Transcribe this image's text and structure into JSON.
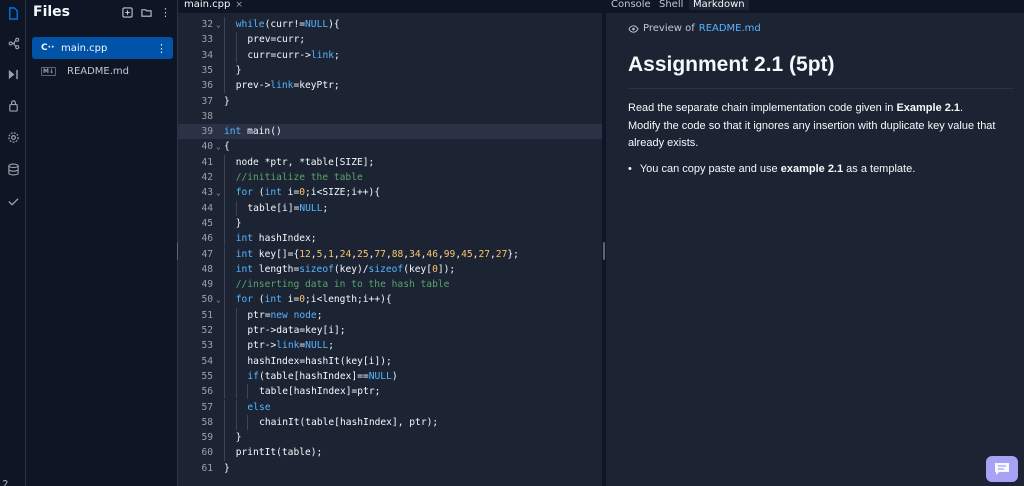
{
  "files_panel": {
    "title": "Files",
    "items": [
      {
        "name": "main.cpp",
        "icon": "C··"
      },
      {
        "name": "README.md",
        "icon": "M↓"
      }
    ]
  },
  "editor": {
    "tab": "main.cpp",
    "lines": [
      {
        "n": "32",
        "fold": true,
        "indent": 1,
        "html": "<span class='kw'>while</span>(curr!=<span class='kw'>NULL</span>){"
      },
      {
        "n": "33",
        "fold": false,
        "indent": 2,
        "html": "prev=curr;"
      },
      {
        "n": "34",
        "fold": false,
        "indent": 2,
        "html": "curr=curr-><span class='kw'>link</span>;"
      },
      {
        "n": "35",
        "fold": false,
        "indent": 1,
        "html": "}"
      },
      {
        "n": "36",
        "fold": false,
        "indent": 1,
        "html": "prev-><span class='kw'>link</span>=keyPtr;"
      },
      {
        "n": "37",
        "fold": false,
        "indent": 0,
        "html": "}"
      },
      {
        "n": "38",
        "fold": false,
        "indent": 0,
        "html": ""
      },
      {
        "n": "39",
        "fold": false,
        "indent": 0,
        "html": "<span class='kw'>int</span> main()",
        "hl": true
      },
      {
        "n": "40",
        "fold": true,
        "indent": 0,
        "html": "{"
      },
      {
        "n": "41",
        "fold": false,
        "indent": 1,
        "html": "node *ptr, *table[SIZE];"
      },
      {
        "n": "42",
        "fold": false,
        "indent": 1,
        "html": "<span class='cm'>//initialize the table</span>"
      },
      {
        "n": "43",
        "fold": true,
        "indent": 1,
        "html": "<span class='kw'>for</span> (<span class='kw'>int</span> i=<span class='num'>0</span>;i&lt;SIZE;i++){"
      },
      {
        "n": "44",
        "fold": false,
        "indent": 2,
        "html": "table[i]=<span class='kw'>NULL</span>;"
      },
      {
        "n": "45",
        "fold": false,
        "indent": 1,
        "html": "}"
      },
      {
        "n": "46",
        "fold": false,
        "indent": 1,
        "html": "<span class='kw'>int</span> hashIndex;"
      },
      {
        "n": "47",
        "fold": false,
        "indent": 1,
        "html": "<span class='kw'>int</span> key[]={<span class='num'>12</span>,<span class='num'>5</span>,<span class='num'>1</span>,<span class='num'>24</span>,<span class='num'>25</span>,<span class='num'>77</span>,<span class='num'>88</span>,<span class='num'>34</span>,<span class='num'>46</span>,<span class='num'>99</span>,<span class='num'>45</span>,<span class='num'>27</span>,<span class='num'>27</span>};"
      },
      {
        "n": "48",
        "fold": false,
        "indent": 1,
        "html": "<span class='kw'>int</span> length=<span class='kw'>sizeof</span>(key)/<span class='kw'>sizeof</span>(key[<span class='num'>0</span>]);"
      },
      {
        "n": "49",
        "fold": false,
        "indent": 1,
        "html": "<span class='cm'>//inserting data in to the hash table</span>"
      },
      {
        "n": "50",
        "fold": true,
        "indent": 1,
        "html": "<span class='kw'>for</span> (<span class='kw'>int</span> i=<span class='num'>0</span>;i&lt;length;i++){"
      },
      {
        "n": "51",
        "fold": false,
        "indent": 2,
        "html": "ptr=<span class='kw'>new</span> <span class='kw'>node</span>;"
      },
      {
        "n": "52",
        "fold": false,
        "indent": 2,
        "html": "ptr->data=key[i];"
      },
      {
        "n": "53",
        "fold": false,
        "indent": 2,
        "html": "ptr-><span class='kw'>link</span>=<span class='kw'>NULL</span>;"
      },
      {
        "n": "54",
        "fold": false,
        "indent": 2,
        "html": "hashIndex=hashIt(key[i]);"
      },
      {
        "n": "55",
        "fold": false,
        "indent": 2,
        "html": "<span class='kw'>if</span>(table[hashIndex]==<span class='kw'>NULL</span>)"
      },
      {
        "n": "56",
        "fold": false,
        "indent": 3,
        "html": "table[hashIndex]=ptr;"
      },
      {
        "n": "57",
        "fold": false,
        "indent": 2,
        "html": "<span class='kw'>else</span>"
      },
      {
        "n": "58",
        "fold": false,
        "indent": 3,
        "html": "chainIt(table[hashIndex], ptr);"
      },
      {
        "n": "59",
        "fold": false,
        "indent": 1,
        "html": "}"
      },
      {
        "n": "60",
        "fold": false,
        "indent": 1,
        "html": "printIt(table);"
      },
      {
        "n": "61",
        "fold": false,
        "indent": 0,
        "html": "}"
      }
    ]
  },
  "right_panel": {
    "tabs": [
      "Console",
      "Shell",
      "Markdown"
    ],
    "active_tab": "Markdown",
    "preview_prefix": "Preview of",
    "preview_file": "README.md",
    "heading": "Assignment 2.1 (5pt)",
    "paragraph_parts": [
      {
        "t": "Read the separate chain implementation code given in ",
        "b": false
      },
      {
        "t": "Example 2.1",
        "b": true
      },
      {
        "t": ". Modify the code so that it ignores any insertion with duplicate key value that already exists.",
        "b": false
      }
    ],
    "bullet_parts": [
      {
        "t": "You can copy paste and use ",
        "b": false
      },
      {
        "t": "example 2.1",
        "b": true
      },
      {
        "t": " as a template.",
        "b": false
      }
    ]
  },
  "colors": {
    "background": "#1c2333",
    "sidebar": "#0e1525",
    "accent": "#0079f2",
    "selected_file": "#0053a6",
    "keyword": "#56b6ff",
    "number": "#fcc56c",
    "comment": "#58a56b",
    "chat_button": "#a7a2f4"
  }
}
